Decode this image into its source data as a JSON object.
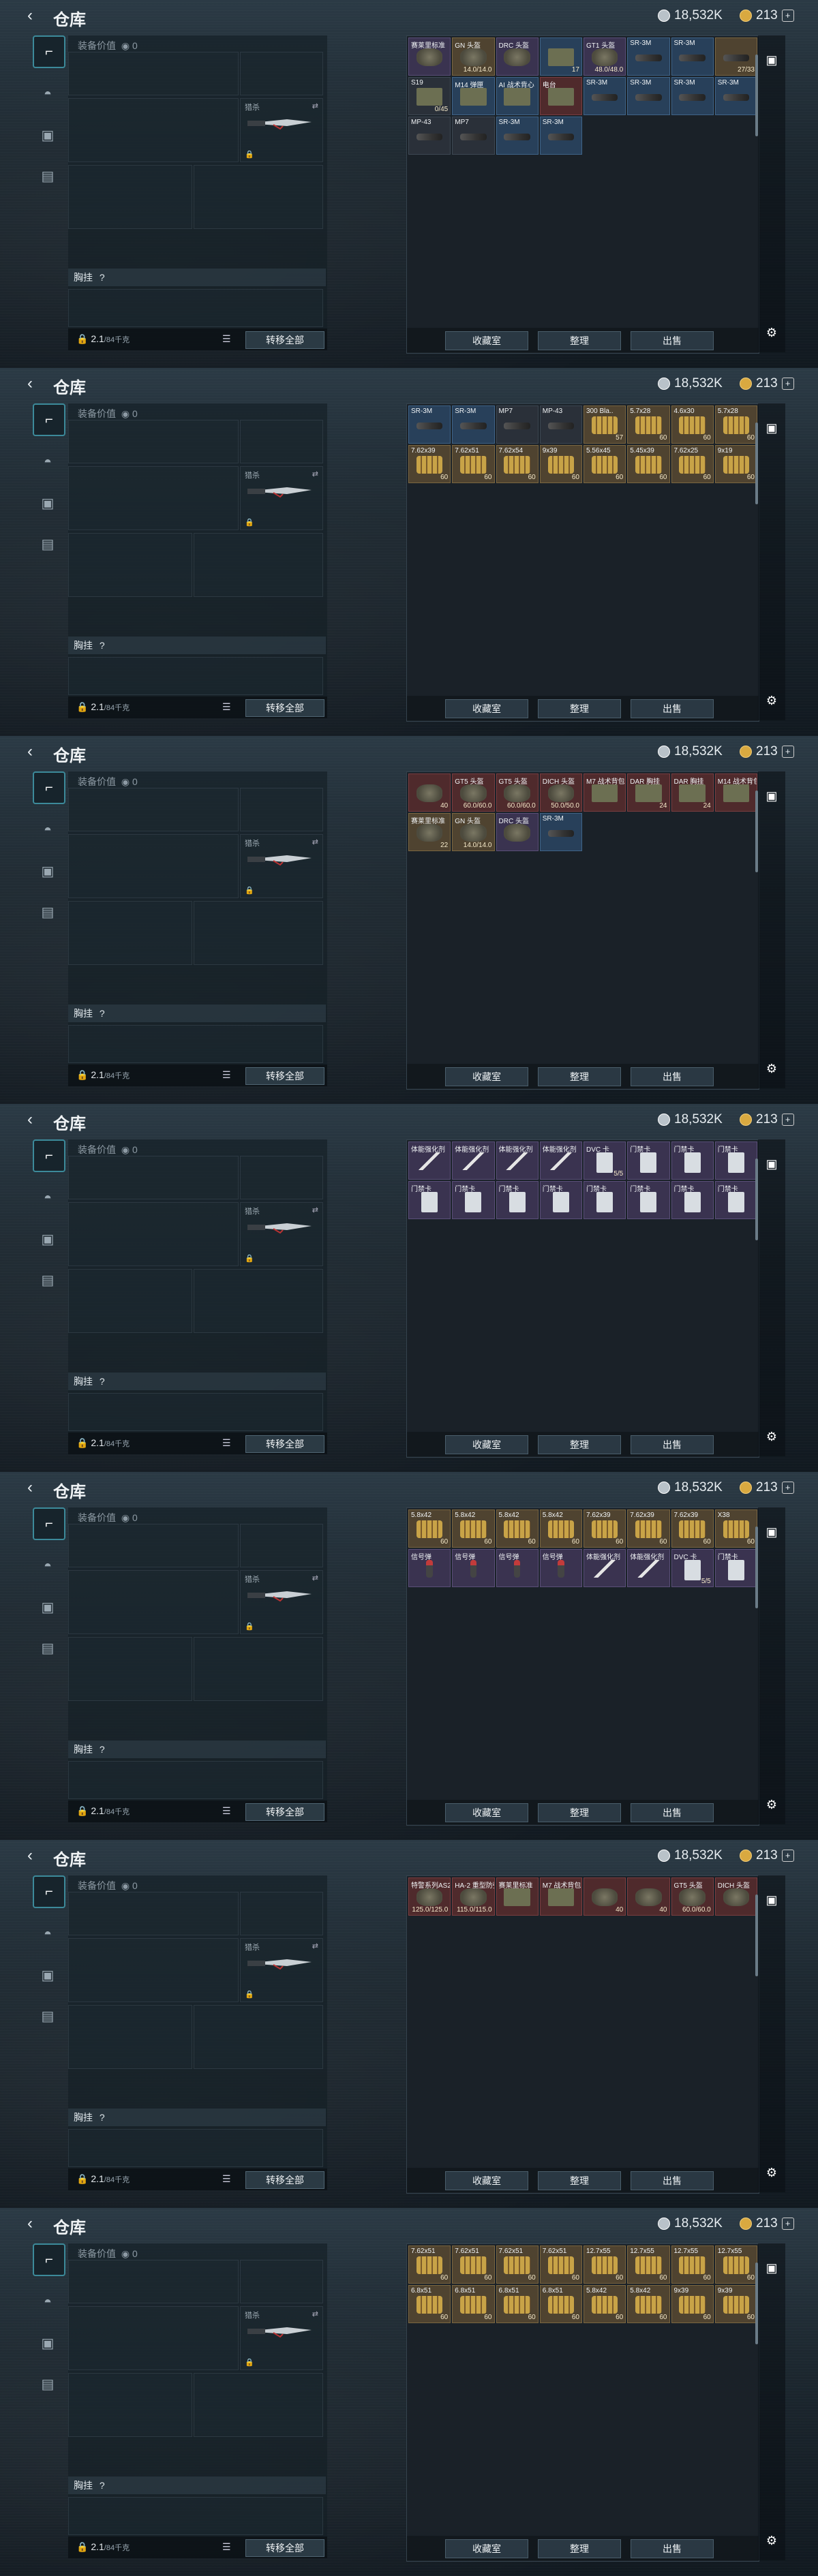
{
  "app": {
    "title": "仓库",
    "currency_silver": "18,532K",
    "currency_gold": "213",
    "back_icon": "back-arrow-icon"
  },
  "loadout": {
    "value_label": "装备价值",
    "value": "0",
    "knife_label": "猎杀",
    "chest_label": "胸挂",
    "chest_hint": "?",
    "weight": "2.1",
    "weight_capacity": "/84千克",
    "transfer_all": "转移全部"
  },
  "inventory_buttons": {
    "stash": "收藏室",
    "organize": "整理",
    "sell": "出售"
  },
  "frames": [
    {
      "cells": [
        {
          "name": "赛莱里标准",
          "val": "",
          "c": "c-purple",
          "art": "armor"
        },
        {
          "name": "GN 头盔",
          "val": "14.0/14.0",
          "c": "c-gold",
          "art": "armor"
        },
        {
          "name": "DRC 头盔",
          "val": "",
          "c": "c-purple",
          "art": "armor"
        },
        {
          "name": "",
          "val": "17",
          "c": "c-blue",
          "art": "box"
        },
        {
          "name": "GT1 头盔",
          "val": "48.0/48.0",
          "c": "c-purple",
          "art": "armor"
        },
        {
          "name": "SR-3M",
          "val": "",
          "c": "c-blue",
          "art": "gun"
        },
        {
          "name": "SR-3M",
          "val": "",
          "c": "c-blue",
          "art": "gun"
        },
        {
          "name": "",
          "val": "27/33",
          "c": "c-gold",
          "art": "gun"
        },
        {
          "name": "S19",
          "val": "0/45",
          "c": "",
          "art": "box"
        },
        {
          "name": "M14 弹匣",
          "val": "",
          "c": "c-blue",
          "art": "box"
        },
        {
          "name": "AI 战术背心",
          "val": "",
          "c": "c-blue",
          "art": "box"
        },
        {
          "name": "电台",
          "val": "",
          "c": "c-red",
          "art": "box"
        },
        {
          "name": "SR-3M",
          "val": "",
          "c": "c-blue",
          "art": "gun"
        },
        {
          "name": "SR-3M",
          "val": "",
          "c": "c-blue",
          "art": "gun"
        },
        {
          "name": "SR-3M",
          "val": "",
          "c": "c-blue",
          "art": "gun"
        },
        {
          "name": "SR-3M",
          "val": "",
          "c": "c-blue",
          "art": "gun"
        },
        {
          "name": "MP-43",
          "val": "",
          "c": "",
          "art": "gun"
        },
        {
          "name": "MP7",
          "val": "",
          "c": "",
          "art": "gun"
        },
        {
          "name": "SR-3M",
          "val": "",
          "c": "c-blue",
          "art": "gun"
        },
        {
          "name": "SR-3M",
          "val": "",
          "c": "c-blue",
          "art": "gun"
        }
      ]
    },
    {
      "cells": [
        {
          "name": "SR-3M",
          "val": "",
          "c": "c-blue",
          "art": "gun"
        },
        {
          "name": "SR-3M",
          "val": "",
          "c": "c-blue",
          "art": "gun"
        },
        {
          "name": "MP7",
          "val": "",
          "c": "",
          "art": "gun"
        },
        {
          "name": "MP-43",
          "val": "",
          "c": "",
          "art": "gun"
        },
        {
          "name": "300 Bla..",
          "val": "57",
          "c": "c-gold",
          "art": "ammo"
        },
        {
          "name": "5.7x28",
          "val": "60",
          "c": "c-gold",
          "art": "ammo"
        },
        {
          "name": "4.6x30",
          "val": "60",
          "c": "c-gold",
          "art": "ammo"
        },
        {
          "name": "5.7x28",
          "val": "60",
          "c": "c-gold",
          "art": "ammo"
        },
        {
          "name": "7.62x39",
          "val": "60",
          "c": "c-gold",
          "art": "ammo"
        },
        {
          "name": "7.62x51",
          "val": "60",
          "c": "c-gold",
          "art": "ammo"
        },
        {
          "name": "7.62x54",
          "val": "60",
          "c": "c-gold",
          "art": "ammo"
        },
        {
          "name": "9x39",
          "val": "60",
          "c": "c-gold",
          "art": "ammo"
        },
        {
          "name": "5.56x45",
          "val": "60",
          "c": "c-gold",
          "art": "ammo"
        },
        {
          "name": "5.45x39",
          "val": "60",
          "c": "c-gold",
          "art": "ammo"
        },
        {
          "name": "7.62x25",
          "val": "60",
          "c": "c-gold",
          "art": "ammo"
        },
        {
          "name": "9x19",
          "val": "60",
          "c": "c-gold",
          "art": "ammo"
        }
      ]
    },
    {
      "cells": [
        {
          "name": "",
          "val": "40",
          "c": "c-red",
          "art": "armor"
        },
        {
          "name": "GT5 头盔",
          "val": "60.0/60.0",
          "c": "c-red",
          "art": "armor"
        },
        {
          "name": "GT5 头盔",
          "val": "60.0/60.0",
          "c": "c-red",
          "art": "armor"
        },
        {
          "name": "DICH 头盔",
          "val": "50.0/50.0",
          "c": "c-red",
          "art": "armor"
        },
        {
          "name": "M7 战术背包",
          "val": "",
          "c": "c-red",
          "art": "box"
        },
        {
          "name": "DAR 胸挂",
          "val": "24",
          "c": "c-red",
          "art": "box"
        },
        {
          "name": "DAR 胸挂",
          "val": "24",
          "c": "c-red",
          "art": "box"
        },
        {
          "name": "M14 战术背包",
          "val": "",
          "c": "c-red",
          "art": "box"
        },
        {
          "name": "赛莱里标准",
          "val": "22",
          "c": "c-gold",
          "art": "armor"
        },
        {
          "name": "GN 头盔",
          "val": "14.0/14.0",
          "c": "c-gold",
          "art": "armor"
        },
        {
          "name": "DRC 头盔",
          "val": "",
          "c": "c-purple",
          "art": "armor"
        },
        {
          "name": "SR-3M",
          "val": "",
          "c": "c-blue",
          "art": "gun"
        }
      ]
    },
    {
      "cells": [
        {
          "name": "体能强化剂",
          "val": "",
          "c": "c-purple",
          "art": "syringe"
        },
        {
          "name": "体能强化剂",
          "val": "",
          "c": "c-purple",
          "art": "syringe"
        },
        {
          "name": "体能强化剂",
          "val": "",
          "c": "c-purple",
          "art": "syringe"
        },
        {
          "name": "体能强化剂",
          "val": "",
          "c": "c-purple",
          "art": "syringe"
        },
        {
          "name": "DVC 卡",
          "val": "5/5",
          "c": "c-purple",
          "art": "card"
        },
        {
          "name": "门禁卡",
          "val": "",
          "c": "c-purple",
          "art": "card"
        },
        {
          "name": "门禁卡",
          "val": "",
          "c": "c-purple",
          "art": "card"
        },
        {
          "name": "门禁卡",
          "val": "",
          "c": "c-purple",
          "art": "card"
        },
        {
          "name": "门禁卡",
          "val": "",
          "c": "c-purple",
          "art": "card"
        },
        {
          "name": "门禁卡",
          "val": "",
          "c": "c-purple",
          "art": "card"
        },
        {
          "name": "门禁卡",
          "val": "",
          "c": "c-purple",
          "art": "card"
        },
        {
          "name": "门禁卡",
          "val": "",
          "c": "c-purple",
          "art": "card"
        },
        {
          "name": "门禁卡",
          "val": "",
          "c": "c-purple",
          "art": "card"
        },
        {
          "name": "门禁卡",
          "val": "",
          "c": "c-purple",
          "art": "card"
        },
        {
          "name": "门禁卡",
          "val": "",
          "c": "c-purple",
          "art": "card"
        },
        {
          "name": "门禁卡",
          "val": "",
          "c": "c-purple",
          "art": "card"
        }
      ]
    },
    {
      "cells": [
        {
          "name": "5.8x42",
          "val": "60",
          "c": "c-gold",
          "art": "ammo"
        },
        {
          "name": "5.8x42",
          "val": "60",
          "c": "c-gold",
          "art": "ammo"
        },
        {
          "name": "5.8x42",
          "val": "60",
          "c": "c-gold",
          "art": "ammo"
        },
        {
          "name": "5.8x42",
          "val": "60",
          "c": "c-gold",
          "art": "ammo"
        },
        {
          "name": "7.62x39",
          "val": "60",
          "c": "c-gold",
          "art": "ammo"
        },
        {
          "name": "7.62x39",
          "val": "60",
          "c": "c-gold",
          "art": "ammo"
        },
        {
          "name": "7.62x39",
          "val": "60",
          "c": "c-gold",
          "art": "ammo"
        },
        {
          "name": "X38",
          "val": "60",
          "c": "c-gold",
          "art": "ammo"
        },
        {
          "name": "信号弹",
          "val": "",
          "c": "c-purple",
          "art": "flare"
        },
        {
          "name": "信号弹",
          "val": "",
          "c": "c-purple",
          "art": "flare"
        },
        {
          "name": "信号弹",
          "val": "",
          "c": "c-purple",
          "art": "flare"
        },
        {
          "name": "信号弹",
          "val": "",
          "c": "c-purple",
          "art": "flare"
        },
        {
          "name": "体能强化剂",
          "val": "",
          "c": "c-purple",
          "art": "syringe"
        },
        {
          "name": "体能强化剂",
          "val": "",
          "c": "c-purple",
          "art": "syringe"
        },
        {
          "name": "DVC 卡",
          "val": "5/5",
          "c": "c-purple",
          "art": "card"
        },
        {
          "name": "门禁卡",
          "val": "",
          "c": "c-purple",
          "art": "card"
        }
      ]
    },
    {
      "cells": [
        {
          "name": "特警系列AS2 D级护甲",
          "val": "125.0/125.0",
          "c": "c-red",
          "art": "armor"
        },
        {
          "name": "HA-2 重型防弹衣",
          "val": "115.0/115.0",
          "c": "c-red",
          "art": "armor"
        },
        {
          "name": "赛莱里标准",
          "val": "",
          "c": "c-red",
          "art": "box"
        },
        {
          "name": "M7 战术背包",
          "val": "",
          "c": "c-red",
          "art": "box"
        },
        {
          "name": "",
          "val": "40",
          "c": "c-red",
          "art": "armor"
        },
        {
          "name": "",
          "val": "40",
          "c": "c-red",
          "art": "armor"
        },
        {
          "name": "GT5 头盔",
          "val": "60.0/60.0",
          "c": "c-red",
          "art": "armor"
        },
        {
          "name": "DICH 头盔",
          "val": "",
          "c": "c-red",
          "art": "armor"
        }
      ]
    },
    {
      "cells": [
        {
          "name": "7.62x51",
          "val": "60",
          "c": "c-gold",
          "art": "ammo"
        },
        {
          "name": "7.62x51",
          "val": "60",
          "c": "c-gold",
          "art": "ammo"
        },
        {
          "name": "7.62x51",
          "val": "60",
          "c": "c-gold",
          "art": "ammo"
        },
        {
          "name": "7.62x51",
          "val": "60",
          "c": "c-gold",
          "art": "ammo"
        },
        {
          "name": "12.7x55",
          "val": "60",
          "c": "c-gold",
          "art": "ammo"
        },
        {
          "name": "12.7x55",
          "val": "60",
          "c": "c-gold",
          "art": "ammo"
        },
        {
          "name": "12.7x55",
          "val": "60",
          "c": "c-gold",
          "art": "ammo"
        },
        {
          "name": "12.7x55",
          "val": "60",
          "c": "c-gold",
          "art": "ammo"
        },
        {
          "name": "6.8x51",
          "val": "60",
          "c": "c-gold",
          "art": "ammo"
        },
        {
          "name": "6.8x51",
          "val": "60",
          "c": "c-gold",
          "art": "ammo"
        },
        {
          "name": "6.8x51",
          "val": "60",
          "c": "c-gold",
          "art": "ammo"
        },
        {
          "name": "6.8x51",
          "val": "60",
          "c": "c-gold",
          "art": "ammo"
        },
        {
          "name": "5.8x42",
          "val": "60",
          "c": "c-gold",
          "art": "ammo"
        },
        {
          "name": "5.8x42",
          "val": "60",
          "c": "c-gold",
          "art": "ammo"
        },
        {
          "name": "9x39",
          "val": "60",
          "c": "c-gold",
          "art": "ammo"
        },
        {
          "name": "9x39",
          "val": "60",
          "c": "c-gold",
          "art": "ammo"
        }
      ]
    }
  ]
}
